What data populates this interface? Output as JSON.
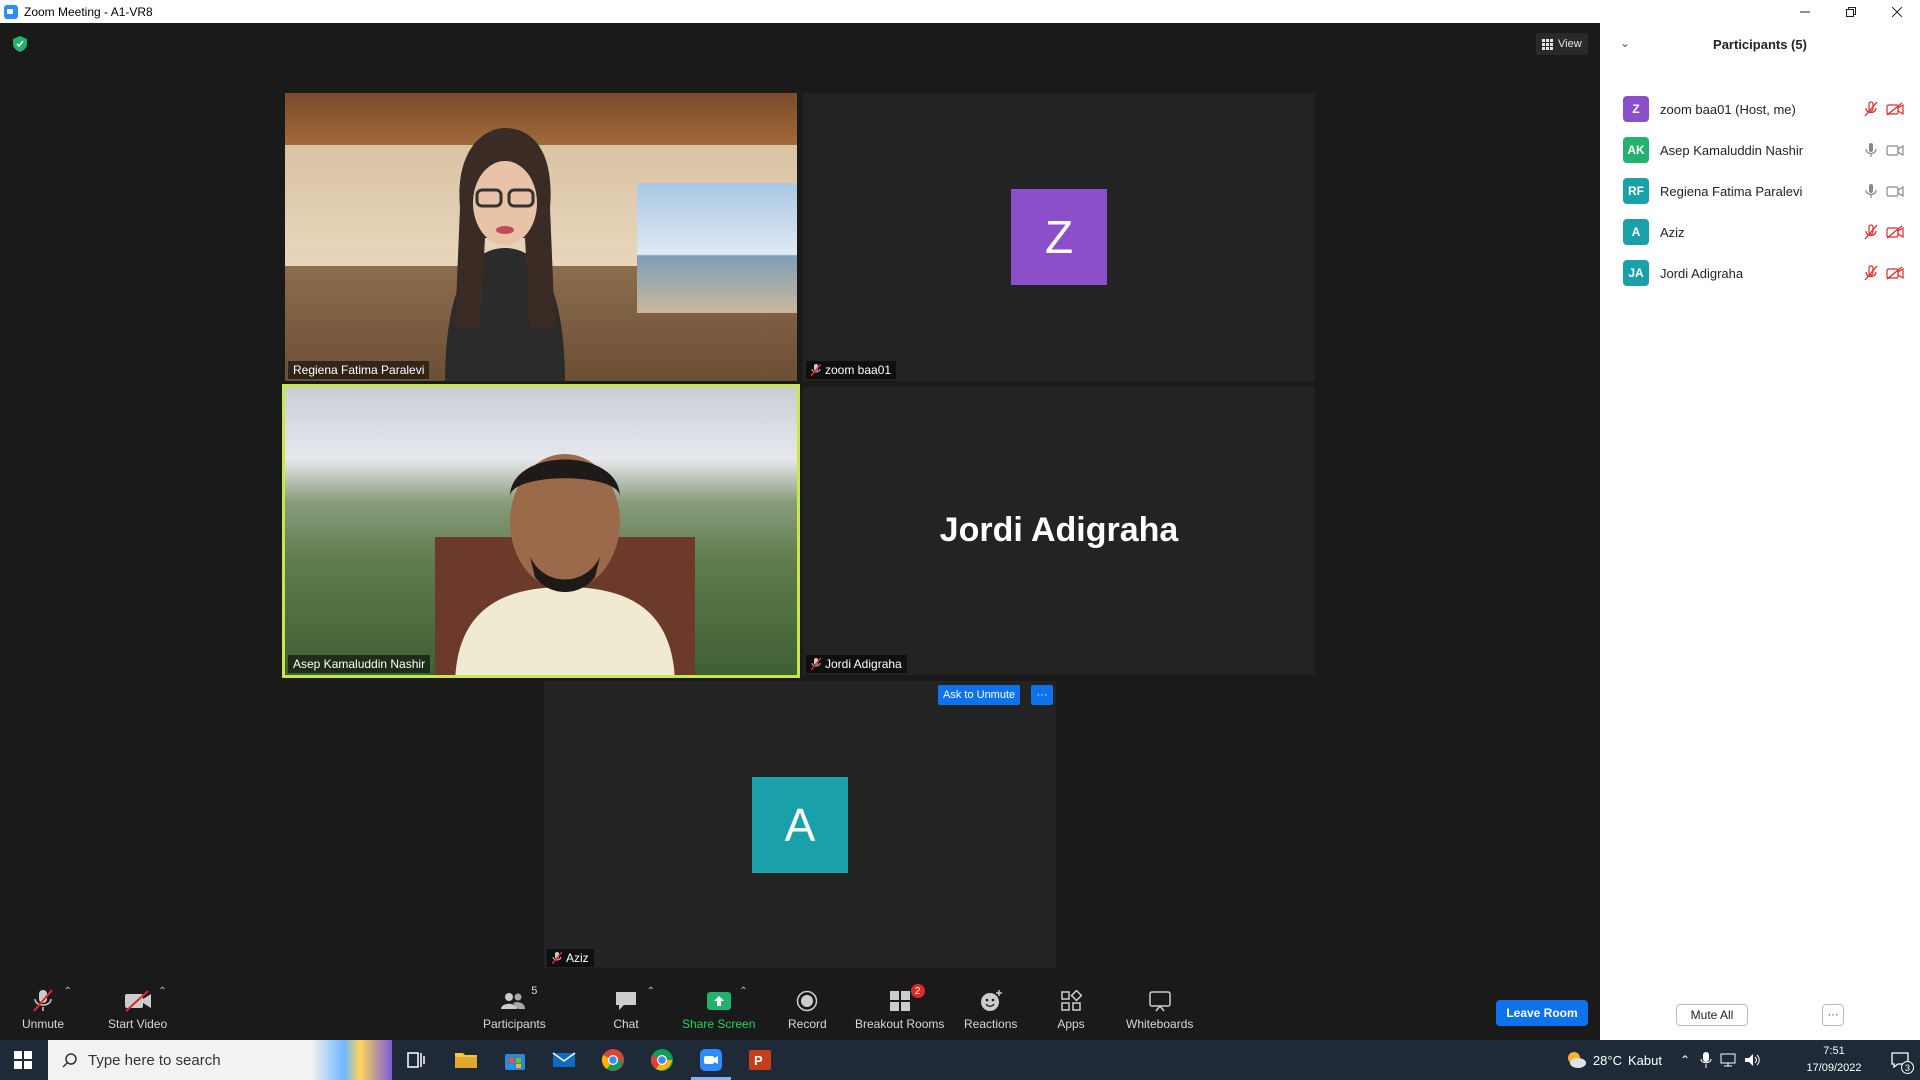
{
  "window": {
    "title": "Zoom Meeting - A1-VR8"
  },
  "meeting": {
    "view_label": "View",
    "tiles": [
      {
        "name": "Regiena Fatima Paralevi",
        "muted": false,
        "video": true
      },
      {
        "name": "zoom baa01",
        "muted": true,
        "video": false,
        "initial": "Z",
        "avatar_color": "#8a4fc9"
      },
      {
        "name": "Asep Kamaluddin Nashir",
        "muted": false,
        "video": true,
        "active_speaker": true
      },
      {
        "name": "Jordi Adigraha",
        "muted": true,
        "video": false,
        "display_name": "Jordi Adigraha"
      },
      {
        "name": "Aziz",
        "muted": true,
        "video": false,
        "initial": "A",
        "avatar_color": "#1aa0a8"
      }
    ],
    "ask_to_unmute_label": "Ask to Unmute",
    "more_label": "···"
  },
  "toolbar": {
    "unmute": "Unmute",
    "start_video": "Start Video",
    "participants": "Participants",
    "participants_count": "5",
    "chat": "Chat",
    "share_screen": "Share Screen",
    "record": "Record",
    "breakout_rooms": "Breakout Rooms",
    "breakout_badge": "2",
    "reactions": "Reactions",
    "apps": "Apps",
    "whiteboards": "Whiteboards",
    "leave": "Leave Room"
  },
  "panel": {
    "title": "Participants (5)",
    "participants": [
      {
        "initials": "Z",
        "name": "zoom baa01 (Host, me)",
        "color": "#8a4fc9",
        "mic": "muted",
        "cam": "off"
      },
      {
        "initials": "AK",
        "name": "Asep Kamaluddin Nashir",
        "color": "#23b26d",
        "mic": "on",
        "cam": "on"
      },
      {
        "initials": "RF",
        "name": "Regiena Fatima Paralevi",
        "color": "#1aa0a8",
        "mic": "on",
        "cam": "on"
      },
      {
        "initials": "A",
        "name": "Aziz",
        "color": "#1aa0a8",
        "mic": "muted",
        "cam": "off"
      },
      {
        "initials": "JA",
        "name": "Jordi Adigraha",
        "color": "#1aa0a8",
        "mic": "muted",
        "cam": "off"
      }
    ],
    "mute_all": "Mute All",
    "more": "···"
  },
  "taskbar": {
    "search_placeholder": "Type here to search",
    "weather_temp": "28°C",
    "weather_text": "Kabut",
    "time": "7:51",
    "date": "17/09/2022",
    "notification_count": "3"
  }
}
